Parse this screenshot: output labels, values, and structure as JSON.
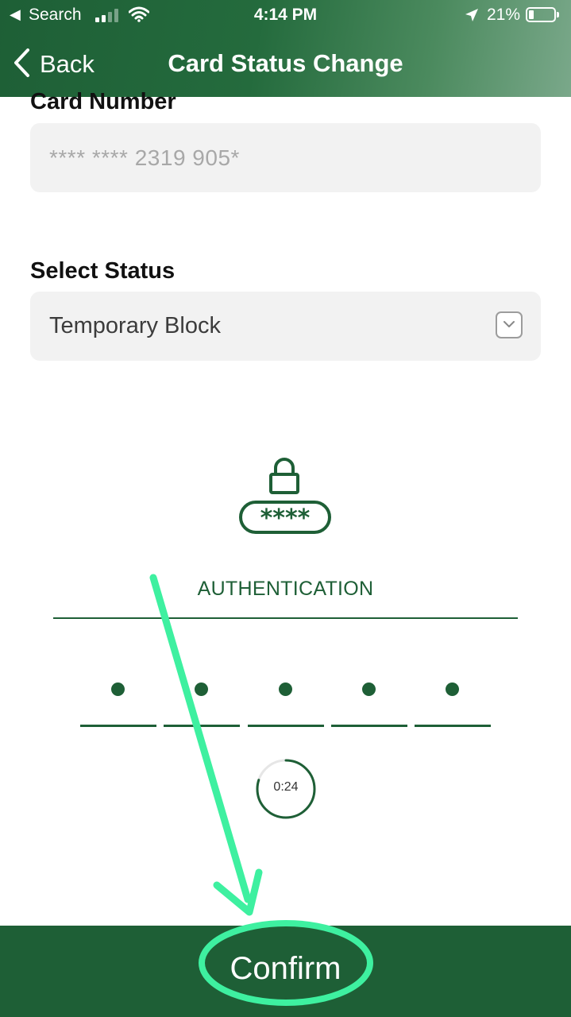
{
  "status_bar": {
    "back_app": "Search",
    "time": "4:14 PM",
    "battery": "21%"
  },
  "nav": {
    "back_label": "Back",
    "title": "Card Status Change"
  },
  "card": {
    "label": "Card Number",
    "value": "**** **** 2319 905*"
  },
  "status": {
    "label": "Select Status",
    "selected": "Temporary Block"
  },
  "auth": {
    "title": "AUTHENTICATION",
    "icon": "lock-password-icon",
    "otp_slots": 5,
    "timer": "0:24",
    "timer_fraction_remaining": 0.8
  },
  "confirm": {
    "label": "Confirm"
  },
  "colors": {
    "brand_green": "#1e5f36",
    "annotation_mint": "#3ef0a0"
  }
}
